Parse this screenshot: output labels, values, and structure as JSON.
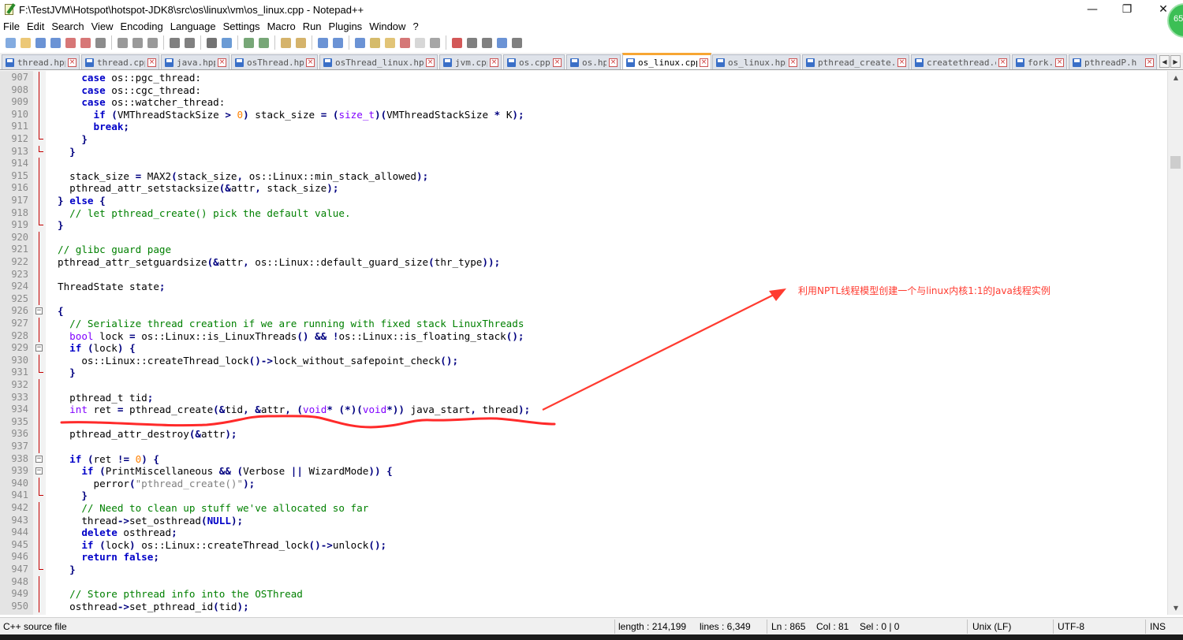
{
  "window": {
    "title": "F:\\TestJVM\\Hotspot\\hotspot-JDK8\\src\\os\\linux\\vm\\os_linux.cpp - Notepad++",
    "minimize_glyph": "—",
    "maximize_glyph": "❐",
    "close_glyph": "✕",
    "badge_text": "65"
  },
  "menu": [
    "File",
    "Edit",
    "Search",
    "View",
    "Encoding",
    "Language",
    "Settings",
    "Macro",
    "Run",
    "Plugins",
    "Window",
    "?"
  ],
  "toolbar_icons": [
    "new-file-icon",
    "open-file-icon",
    "save-icon",
    "save-all-icon",
    "close-icon",
    "close-all-icon",
    "print-icon",
    "sep",
    "cut-icon",
    "copy-icon",
    "paste-icon",
    "sep",
    "undo-icon",
    "redo-icon",
    "sep",
    "find-icon",
    "replace-icon",
    "sep",
    "zoom-in-icon",
    "zoom-out-icon",
    "sep",
    "sync-v-icon",
    "sync-h-icon",
    "sep",
    "word-wrap-icon",
    "show-all-chars-icon",
    "sep",
    "indent-guide-icon",
    "lang-icon",
    "folder-icon",
    "doc-map-icon",
    "function-list-icon",
    "monitor-icon",
    "sep",
    "record-macro-icon",
    "stop-macro-icon",
    "play-macro-icon",
    "run-macro-multiple-icon",
    "save-macro-icon"
  ],
  "tabs": [
    {
      "label": "thread.hpp",
      "active": false
    },
    {
      "label": "thread.cpp",
      "active": false
    },
    {
      "label": "java.hpp",
      "active": false
    },
    {
      "label": "osThread.hpp",
      "active": false
    },
    {
      "label": "osThread_linux.hpp",
      "active": false
    },
    {
      "label": "jvm.cpp",
      "active": false
    },
    {
      "label": "os.cpp",
      "active": false
    },
    {
      "label": "os.hpp",
      "active": false
    },
    {
      "label": "os_linux.cpp",
      "active": true
    },
    {
      "label": "os_linux.hpp",
      "active": false
    },
    {
      "label": "pthread_create.c",
      "active": false
    },
    {
      "label": "createthread.c",
      "active": false
    },
    {
      "label": "fork.c",
      "active": false
    },
    {
      "label": "pthreadP.h",
      "active": false
    }
  ],
  "tab_close_glyph": "×",
  "tab_scroll_left": "◀",
  "tab_scroll_right": "▶",
  "editor": {
    "lines": [
      {
        "n": "907",
        "fold": "line",
        "code": [
          [
            "",
            "    "
          ],
          [
            "kw",
            "case"
          ],
          [
            "",
            " os::pgc_thread:"
          ]
        ]
      },
      {
        "n": "908",
        "fold": "line",
        "code": [
          [
            "",
            "    "
          ],
          [
            "kw",
            "case"
          ],
          [
            "",
            " os::cgc_thread:"
          ]
        ]
      },
      {
        "n": "909",
        "fold": "line",
        "code": [
          [
            "",
            "    "
          ],
          [
            "kw",
            "case"
          ],
          [
            "",
            " os::watcher_thread:"
          ]
        ]
      },
      {
        "n": "910",
        "fold": "line",
        "code": [
          [
            "",
            "      "
          ],
          [
            "kw",
            "if"
          ],
          [
            "",
            " "
          ],
          [
            "op",
            "("
          ],
          [
            "",
            "VMThreadStackSize "
          ],
          [
            "op",
            ">"
          ],
          [
            "",
            " "
          ],
          [
            "num",
            "0"
          ],
          [
            "op",
            ")"
          ],
          [
            "",
            " stack_size "
          ],
          [
            "op",
            "="
          ],
          [
            "",
            " "
          ],
          [
            "op",
            "("
          ],
          [
            "ty",
            "size_t"
          ],
          [
            "op",
            ")("
          ],
          [
            "",
            "VMThreadStackSize "
          ],
          [
            "op",
            "*"
          ],
          [
            "",
            " K"
          ],
          [
            "op",
            ");"
          ]
        ]
      },
      {
        "n": "911",
        "fold": "line",
        "code": [
          [
            "",
            "      "
          ],
          [
            "kw",
            "break"
          ],
          [
            "op",
            ";"
          ]
        ]
      },
      {
        "n": "912",
        "fold": "end",
        "code": [
          [
            "",
            "    "
          ],
          [
            "op",
            "}"
          ]
        ]
      },
      {
        "n": "913",
        "fold": "end",
        "code": [
          [
            "",
            "  "
          ],
          [
            "op",
            "}"
          ]
        ]
      },
      {
        "n": "914",
        "fold": "line",
        "code": []
      },
      {
        "n": "915",
        "fold": "line",
        "code": [
          [
            "",
            "  stack_size "
          ],
          [
            "op",
            "="
          ],
          [
            "",
            " MAX2"
          ],
          [
            "op",
            "("
          ],
          [
            "",
            "stack_size"
          ],
          [
            "op",
            ","
          ],
          [
            "",
            " os::Linux::min_stack_allowed"
          ],
          [
            "op",
            ");"
          ]
        ]
      },
      {
        "n": "916",
        "fold": "line",
        "code": [
          [
            "",
            "  pthread_attr_setstacksize"
          ],
          [
            "op",
            "(&"
          ],
          [
            "",
            "attr"
          ],
          [
            "op",
            ","
          ],
          [
            "",
            " stack_size"
          ],
          [
            "op",
            ");"
          ]
        ]
      },
      {
        "n": "917",
        "fold": "line",
        "code": [
          [
            "op",
            "}"
          ],
          [
            "",
            " "
          ],
          [
            "kw",
            "else"
          ],
          [
            "",
            " "
          ],
          [
            "op",
            "{"
          ]
        ]
      },
      {
        "n": "918",
        "fold": "line",
        "code": [
          [
            "",
            "  "
          ],
          [
            "cm",
            "// let pthread_create() pick the default value."
          ]
        ]
      },
      {
        "n": "919",
        "fold": "end",
        "code": [
          [
            "op",
            "}"
          ]
        ]
      },
      {
        "n": "920",
        "fold": "line",
        "code": []
      },
      {
        "n": "921",
        "fold": "line",
        "code": [
          [
            "cm",
            "// glibc guard page"
          ]
        ]
      },
      {
        "n": "922",
        "fold": "line",
        "code": [
          [
            "",
            "pthread_attr_setguardsize"
          ],
          [
            "op",
            "(&"
          ],
          [
            "",
            "attr"
          ],
          [
            "op",
            ","
          ],
          [
            "",
            " os::Linux::default_guard_size"
          ],
          [
            "op",
            "("
          ],
          [
            "",
            "thr_type"
          ],
          [
            "op",
            "));"
          ]
        ]
      },
      {
        "n": "923",
        "fold": "line",
        "code": []
      },
      {
        "n": "924",
        "fold": "line",
        "code": [
          [
            "",
            "ThreadState state"
          ],
          [
            "op",
            ";"
          ]
        ]
      },
      {
        "n": "925",
        "fold": "line",
        "code": []
      },
      {
        "n": "926",
        "fold": "box",
        "code": [
          [
            "op",
            "{"
          ]
        ]
      },
      {
        "n": "927",
        "fold": "line",
        "code": [
          [
            "",
            "  "
          ],
          [
            "cm",
            "// Serialize thread creation if we are running with fixed stack LinuxThreads"
          ]
        ]
      },
      {
        "n": "928",
        "fold": "line",
        "code": [
          [
            "",
            "  "
          ],
          [
            "ty",
            "bool"
          ],
          [
            "",
            " lock "
          ],
          [
            "op",
            "="
          ],
          [
            "",
            " os::Linux::is_LinuxThreads"
          ],
          [
            "op",
            "()"
          ],
          [
            "",
            " "
          ],
          [
            "op",
            "&&"
          ],
          [
            "",
            " "
          ],
          [
            "op",
            "!"
          ],
          [
            "",
            "os::Linux::is_floating_stack"
          ],
          [
            "op",
            "();"
          ]
        ]
      },
      {
        "n": "929",
        "fold": "box",
        "code": [
          [
            "",
            "  "
          ],
          [
            "kw",
            "if"
          ],
          [
            "",
            " "
          ],
          [
            "op",
            "("
          ],
          [
            "",
            "lock"
          ],
          [
            "op",
            ")"
          ],
          [
            "",
            " "
          ],
          [
            "op",
            "{"
          ]
        ]
      },
      {
        "n": "930",
        "fold": "line",
        "code": [
          [
            "",
            "    os::Linux::createThread_lock"
          ],
          [
            "op",
            "()->"
          ],
          [
            "",
            "lock_without_safepoint_check"
          ],
          [
            "op",
            "();"
          ]
        ]
      },
      {
        "n": "931",
        "fold": "end",
        "code": [
          [
            "",
            "  "
          ],
          [
            "op",
            "}"
          ]
        ]
      },
      {
        "n": "932",
        "fold": "line",
        "code": []
      },
      {
        "n": "933",
        "fold": "line",
        "code": [
          [
            "",
            "  pthread_t tid"
          ],
          [
            "op",
            ";"
          ]
        ]
      },
      {
        "n": "934",
        "fold": "line",
        "code": [
          [
            "",
            "  "
          ],
          [
            "ty",
            "int"
          ],
          [
            "",
            " ret "
          ],
          [
            "op",
            "="
          ],
          [
            "",
            " pthread_create"
          ],
          [
            "op",
            "(&"
          ],
          [
            "",
            "tid"
          ],
          [
            "op",
            ","
          ],
          [
            "",
            " "
          ],
          [
            "op",
            "&"
          ],
          [
            "",
            "attr"
          ],
          [
            "op",
            ","
          ],
          [
            "",
            " "
          ],
          [
            "op",
            "("
          ],
          [
            "ty",
            "void"
          ],
          [
            "op",
            "*"
          ],
          [
            "",
            " "
          ],
          [
            "op",
            "(*)("
          ],
          [
            "ty",
            "void"
          ],
          [
            "op",
            "*))"
          ],
          [
            "",
            " java_start"
          ],
          [
            "op",
            ","
          ],
          [
            "",
            " thread"
          ],
          [
            "op",
            ");"
          ]
        ]
      },
      {
        "n": "935",
        "fold": "line",
        "code": []
      },
      {
        "n": "936",
        "fold": "line",
        "code": [
          [
            "",
            "  pthread_attr_destroy"
          ],
          [
            "op",
            "(&"
          ],
          [
            "",
            "attr"
          ],
          [
            "op",
            ");"
          ]
        ]
      },
      {
        "n": "937",
        "fold": "line",
        "code": []
      },
      {
        "n": "938",
        "fold": "box",
        "code": [
          [
            "",
            "  "
          ],
          [
            "kw",
            "if"
          ],
          [
            "",
            " "
          ],
          [
            "op",
            "("
          ],
          [
            "",
            "ret "
          ],
          [
            "op",
            "!="
          ],
          [
            "",
            " "
          ],
          [
            "num",
            "0"
          ],
          [
            "op",
            ")"
          ],
          [
            "",
            " "
          ],
          [
            "op",
            "{"
          ]
        ]
      },
      {
        "n": "939",
        "fold": "box",
        "code": [
          [
            "",
            "    "
          ],
          [
            "kw",
            "if"
          ],
          [
            "",
            " "
          ],
          [
            "op",
            "("
          ],
          [
            "",
            "PrintMiscellaneous "
          ],
          [
            "op",
            "&&"
          ],
          [
            "",
            " "
          ],
          [
            "op",
            "("
          ],
          [
            "",
            "Verbose "
          ],
          [
            "op",
            "||"
          ],
          [
            "",
            " WizardMode"
          ],
          [
            "op",
            "))"
          ],
          [
            "",
            " "
          ],
          [
            "op",
            "{"
          ]
        ]
      },
      {
        "n": "940",
        "fold": "line",
        "code": [
          [
            "",
            "      perror"
          ],
          [
            "op",
            "("
          ],
          [
            "st",
            "\"pthread_create()\""
          ],
          [
            "op",
            ");"
          ]
        ]
      },
      {
        "n": "941",
        "fold": "end",
        "code": [
          [
            "",
            "    "
          ],
          [
            "op",
            "}"
          ]
        ]
      },
      {
        "n": "942",
        "fold": "line",
        "code": [
          [
            "",
            "    "
          ],
          [
            "cm",
            "// Need to clean up stuff we've allocated so far"
          ]
        ]
      },
      {
        "n": "943",
        "fold": "line",
        "code": [
          [
            "",
            "    thread"
          ],
          [
            "op",
            "->"
          ],
          [
            "",
            "set_osthread"
          ],
          [
            "op",
            "("
          ],
          [
            "kw",
            "NULL"
          ],
          [
            "op",
            ");"
          ]
        ]
      },
      {
        "n": "944",
        "fold": "line",
        "code": [
          [
            "",
            "    "
          ],
          [
            "kw",
            "delete"
          ],
          [
            "",
            " osthread"
          ],
          [
            "op",
            ";"
          ]
        ]
      },
      {
        "n": "945",
        "fold": "line",
        "code": [
          [
            "",
            "    "
          ],
          [
            "kw",
            "if"
          ],
          [
            "",
            " "
          ],
          [
            "op",
            "("
          ],
          [
            "",
            "lock"
          ],
          [
            "op",
            ")"
          ],
          [
            "",
            " os::Linux::createThread_lock"
          ],
          [
            "op",
            "()->"
          ],
          [
            "",
            "unlock"
          ],
          [
            "op",
            "();"
          ]
        ]
      },
      {
        "n": "946",
        "fold": "line",
        "code": [
          [
            "",
            "    "
          ],
          [
            "kw",
            "return"
          ],
          [
            "",
            " "
          ],
          [
            "kw",
            "false"
          ],
          [
            "op",
            ";"
          ]
        ]
      },
      {
        "n": "947",
        "fold": "end",
        "code": [
          [
            "",
            "  "
          ],
          [
            "op",
            "}"
          ]
        ]
      },
      {
        "n": "948",
        "fold": "line",
        "code": []
      },
      {
        "n": "949",
        "fold": "line",
        "code": [
          [
            "",
            "  "
          ],
          [
            "cm",
            "// Store pthread info into the OSThread"
          ]
        ]
      },
      {
        "n": "950",
        "fold": "line",
        "code": [
          [
            "",
            "  osthread"
          ],
          [
            "op",
            "->"
          ],
          [
            "",
            "set_pthread_id"
          ],
          [
            "op",
            "("
          ],
          [
            "",
            "tid"
          ],
          [
            "op",
            ");"
          ]
        ]
      }
    ]
  },
  "annotation": {
    "text": "利用NPTL线程模型创建一个与linux内核1:1的Java线程实例",
    "color": "#ff3b30"
  },
  "scroll": {
    "up": "▲",
    "down": "▼"
  },
  "status": {
    "file_type": "C++ source file",
    "length": "length : 214,199",
    "lines": "lines : 6,349",
    "ln": "Ln : 865",
    "col": "Col : 81",
    "sel": "Sel : 0 | 0",
    "eol": "Unix (LF)",
    "encoding": "UTF-8",
    "mode": "INS"
  },
  "colors": {
    "keyword": "#0000c8",
    "type": "#8000ff",
    "comment": "#008000",
    "number": "#ff8000",
    "operator": "#000080",
    "tab_accent": "#f7a633"
  }
}
